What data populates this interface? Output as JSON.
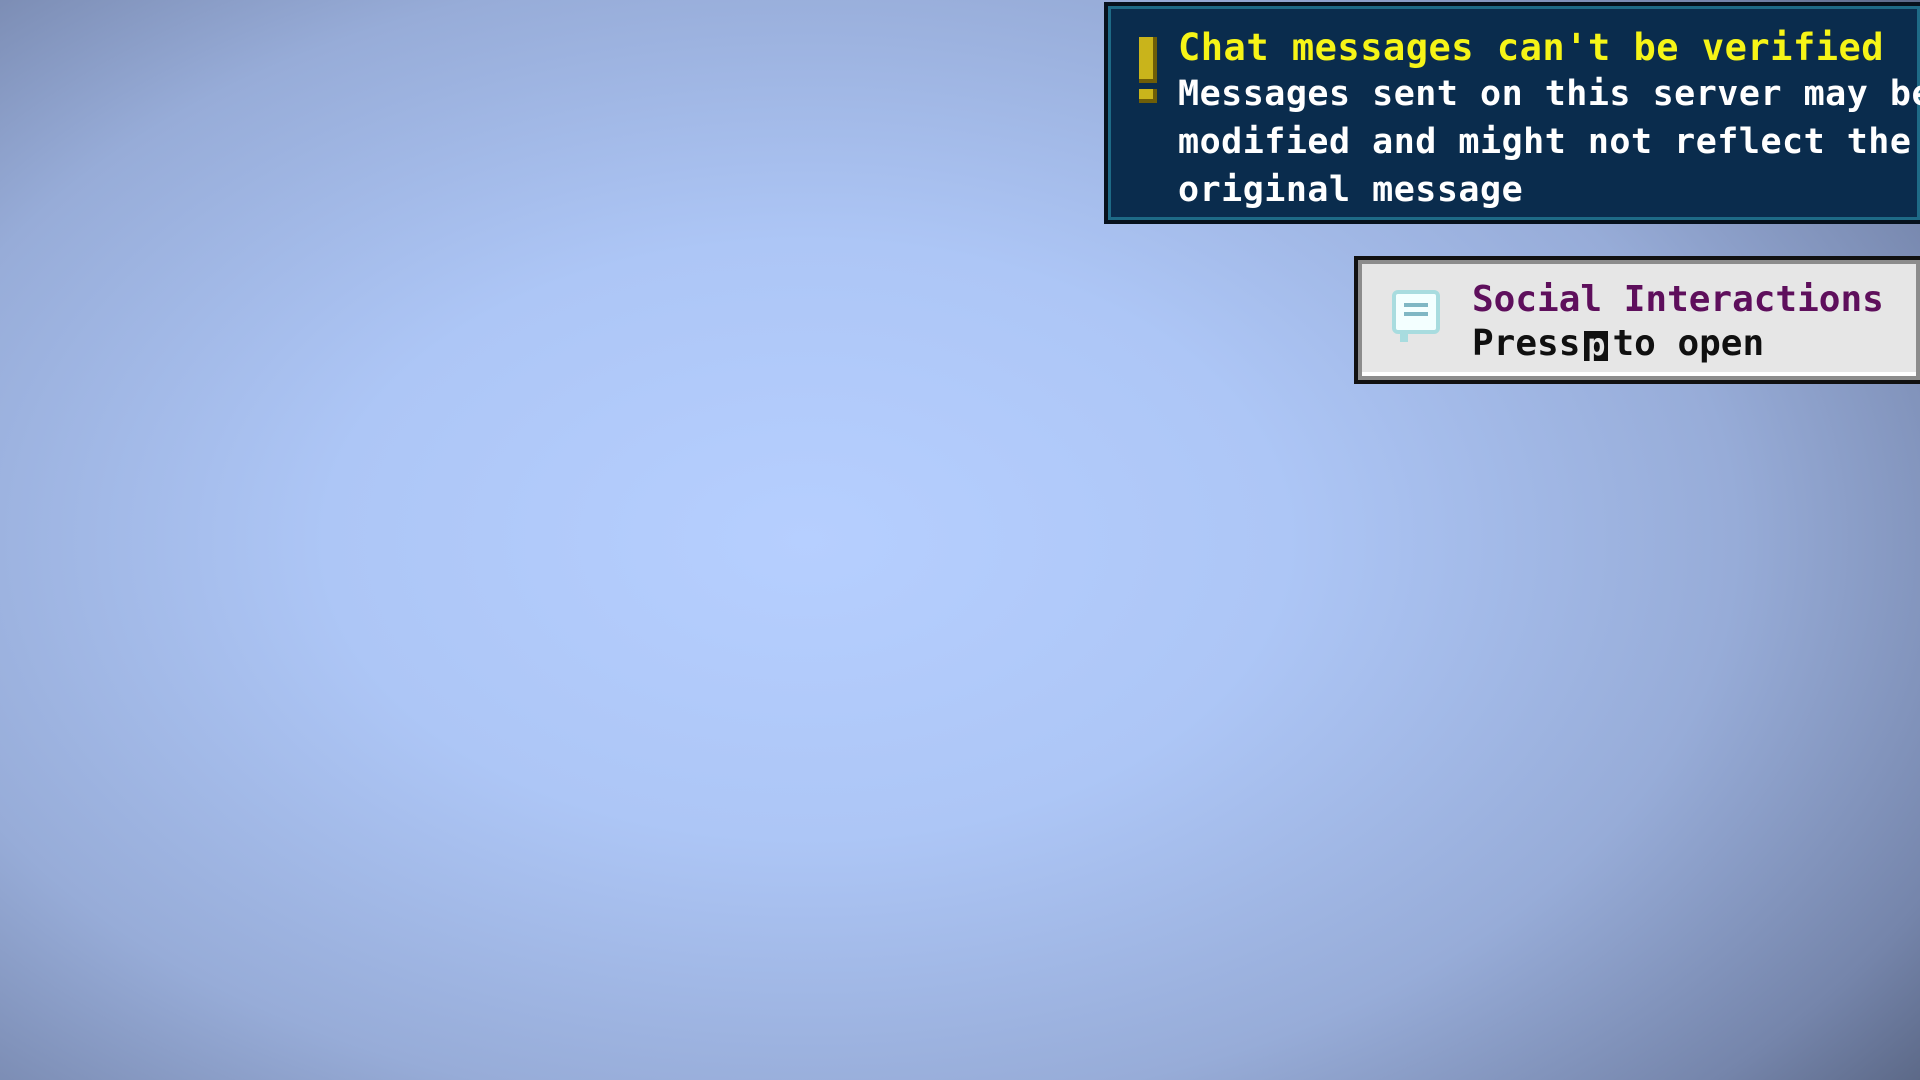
{
  "warning_toast": {
    "icon": "exclamation-icon",
    "title": "Chat messages can't be verified",
    "body_lines": [
      "Messages sent on this server may be",
      "modified and might not reflect the",
      "original message"
    ],
    "colors": {
      "background": "#0a2c4d",
      "title": "#f6f417",
      "body": "#ffffff"
    }
  },
  "social_toast": {
    "icon": "chat-bubble-icon",
    "title": "Social Interactions",
    "press_prefix": "Press",
    "key": "p",
    "press_suffix": "to open",
    "colors": {
      "background": "#e6e6e6",
      "title": "#5e0f5c",
      "body": "#101010"
    }
  }
}
